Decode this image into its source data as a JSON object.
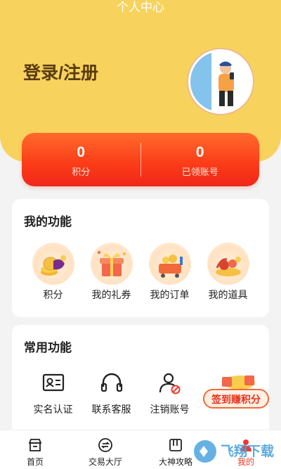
{
  "header": {
    "title": "个人中心",
    "login_label": "登录/注册"
  },
  "stats": [
    {
      "value": "0",
      "label": "积分"
    },
    {
      "value": "0",
      "label": "已领账号"
    }
  ],
  "my_functions": {
    "title": "我的功能",
    "items": [
      {
        "label": "积分",
        "icon": "coins-icon"
      },
      {
        "label": "我的礼券",
        "icon": "gift-box-icon"
      },
      {
        "label": "我的订单",
        "icon": "order-cart-icon"
      },
      {
        "label": "我的道具",
        "icon": "treasure-props-icon"
      }
    ]
  },
  "common_functions": {
    "title": "常用功能",
    "items": [
      {
        "label": "实名认证",
        "icon": "id-card-icon"
      },
      {
        "label": "联系客服",
        "icon": "headset-icon"
      },
      {
        "label": "注销账号",
        "icon": "user-cancel-icon"
      }
    ]
  },
  "promo": {
    "label": "签到赚积分"
  },
  "bottom_nav": [
    {
      "label": "首页",
      "icon": "store-icon"
    },
    {
      "label": "交易大厅",
      "icon": "exchange-icon"
    },
    {
      "label": "大神攻略",
      "icon": "guide-book-icon"
    },
    {
      "label": "我的",
      "icon": "user-icon",
      "active": true
    }
  ],
  "watermark": {
    "text": "飞翔下载"
  },
  "colors": {
    "header": "#f7d35e",
    "stats_gradient_top": "#ff6a2b",
    "stats_gradient_bottom": "#f0261a",
    "active_nav": "#f03a2a"
  }
}
